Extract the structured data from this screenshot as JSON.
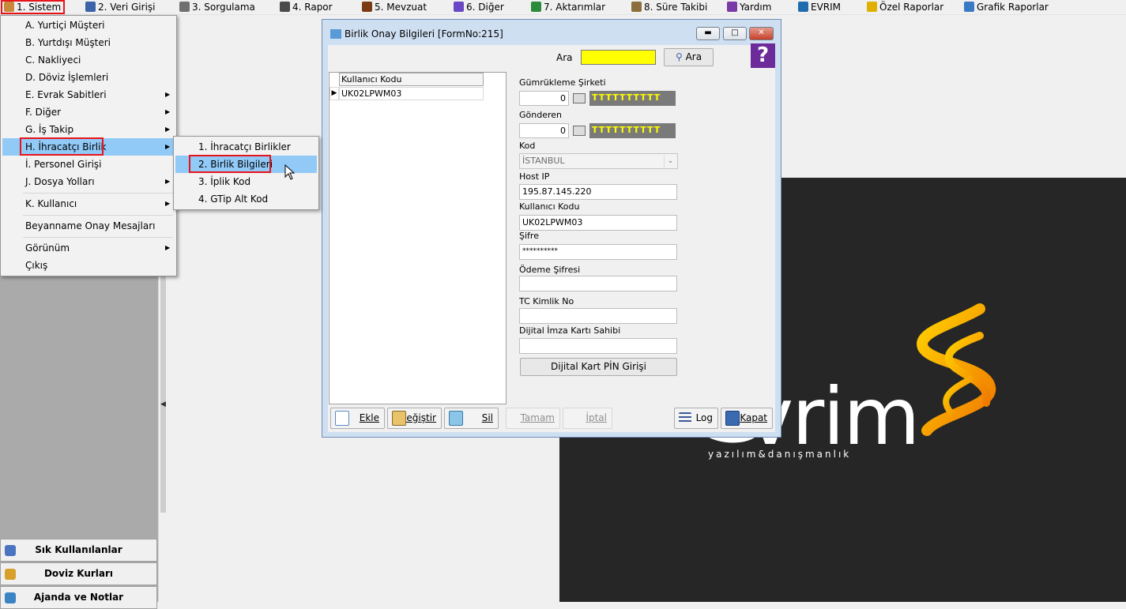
{
  "menubar": {
    "items": [
      {
        "label": "1.  Sistem",
        "icon": "gear-icon",
        "color": "#c88a3a"
      },
      {
        "label": "2.  Veri Girişi",
        "icon": "edit-icon",
        "color": "#3a63a8"
      },
      {
        "label": "3.  Sorgulama",
        "icon": "query-icon",
        "color": "#707070"
      },
      {
        "label": "4.  Rapor",
        "icon": "printer-icon",
        "color": "#4a4a4a"
      },
      {
        "label": "5.  Mevzuat",
        "icon": "books-icon",
        "color": "#7a3b14"
      },
      {
        "label": "6.  Diğer",
        "icon": "misc-icon",
        "color": "#6a47c4"
      },
      {
        "label": "7.  Aktarımlar",
        "icon": "transfer-icon",
        "color": "#2c8b3a"
      },
      {
        "label": "8. Süre Takibi",
        "icon": "clipboard-icon",
        "color": "#8b6e3a"
      },
      {
        "label": "Yardım",
        "icon": "help-icon",
        "color": "#7a3aa8"
      },
      {
        "label": "EVRIM",
        "icon": "evrim-icon",
        "color": "#1f6bb0"
      },
      {
        "label": "Özel Raporlar",
        "icon": "star-icon",
        "color": "#e0b000"
      },
      {
        "label": "Grafik Raporlar",
        "icon": "chart-icon",
        "color": "#3a7ac4"
      }
    ]
  },
  "sistem_menu": {
    "items": [
      {
        "label": "A.   Yurtiçi Müşteri",
        "submenu": false
      },
      {
        "label": "B.   Yurtdışı Müşteri",
        "submenu": false
      },
      {
        "label": "C.   Nakliyeci",
        "submenu": false
      },
      {
        "label": "D.   Döviz İşlemleri",
        "submenu": false
      },
      {
        "label": "E.   Evrak Sabitleri",
        "submenu": true
      },
      {
        "label": "F.   Diğer",
        "submenu": true
      },
      {
        "label": "G.   İş Takip",
        "submenu": true
      },
      {
        "label": "H.   İhracatçı Birlik",
        "submenu": true
      },
      {
        "label": "İ.    Personel Girişi",
        "submenu": false
      },
      {
        "label": "J.   Dosya Yolları",
        "submenu": true
      },
      {
        "label": "K.   Kullanıcı",
        "submenu": true
      },
      {
        "label": "Beyanname Onay Mesajları",
        "submenu": false
      },
      {
        "label": "Görünüm",
        "submenu": true
      },
      {
        "label": "Çıkış",
        "submenu": false
      }
    ]
  },
  "birlik_submenu": {
    "items": [
      {
        "label": "1.   İhracatçı Birlikler"
      },
      {
        "label": "2.   Birlik Bilgileri"
      },
      {
        "label": "3.   İplik Kod"
      },
      {
        "label": "4.   GTip Alt Kod"
      }
    ]
  },
  "sidebar": {
    "buttons": [
      {
        "label": "Sık Kullanılanlar",
        "icon": "favorites-icon",
        "color": "#4a74c0"
      },
      {
        "label": "Doviz Kurları",
        "icon": "currency-icon",
        "color": "#d6a02a"
      },
      {
        "label": "Ajanda ve Notlar",
        "icon": "agenda-icon",
        "color": "#3a84c4"
      }
    ]
  },
  "window": {
    "title": "Birlik Onay Bilgileri [FormNo:215]",
    "ara_label": "Ara",
    "ara_value": "",
    "ara_button": "Ara",
    "grid": {
      "header": "Kullanıcı Kodu",
      "rows": [
        "UK02LPWM03"
      ]
    },
    "form": {
      "gumrukleme_label": "Gümrükleme Şirketi",
      "gumrukleme_num": "0",
      "gumrukleme_name": "TTTTTTTTTT",
      "gonderen_label": "Gönderen",
      "gonderen_num": "0",
      "gonderen_name": "TTTTTTTTTT",
      "kod_label": "Kod",
      "kod_value": "İSTANBUL",
      "host_label": "Host IP",
      "host_value": "195.87.145.220",
      "kullanici_label": "Kullanıcı Kodu",
      "kullanici_value": "UK02LPWM03",
      "sifre_label": "Şifre",
      "sifre_value": "**********",
      "odeme_label": "Ödeme Şifresi",
      "odeme_value": "",
      "tc_label": "TC Kimlik No",
      "tc_value": "",
      "dijital_label": "Dijital İmza Kartı Sahibi",
      "dijital_value": "",
      "pin_button": "Dijital Kart PİN Girişi"
    },
    "buttons": {
      "ekle": "Ekle",
      "degistir": "Değiştir",
      "sil": "Sil",
      "tamam": "Tamam",
      "iptal": "İptal",
      "log": "Log",
      "kapat": "Kapat"
    }
  },
  "logo": {
    "text": "vrim",
    "subtitle": "yazılım&danışmanlık",
    "accent": "#f5a800"
  }
}
